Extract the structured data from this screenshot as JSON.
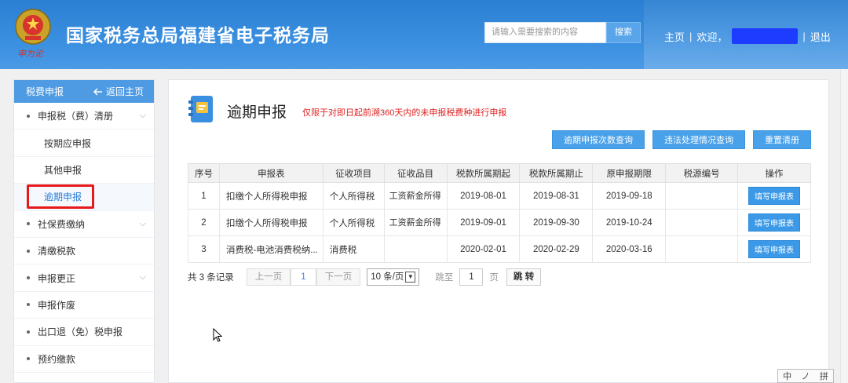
{
  "header": {
    "site_title": "国家税务总局福建省电子税务局",
    "signature": "申为论",
    "search_placeholder": "请输入需要搜索的内容",
    "search_button": "搜索",
    "nav_home": "主页",
    "nav_sep": "|",
    "nav_welcome": "欢迎，",
    "nav_logout": "退出"
  },
  "sidebar": {
    "title": "税费申报",
    "back_label": "返回主页",
    "items": [
      {
        "label": "申报税（费）清册"
      },
      {
        "label": "按期应申报"
      },
      {
        "label": "其他申报"
      },
      {
        "label": "逾期申报"
      },
      {
        "label": "社保费缴纳"
      },
      {
        "label": "清缴税款"
      },
      {
        "label": "申报更正"
      },
      {
        "label": "申报作废"
      },
      {
        "label": "出口退（免）税申报"
      },
      {
        "label": "预约缴款"
      }
    ]
  },
  "main": {
    "title": "逾期申报",
    "note": "仅限于对即日起前溯360天内的未申报税费种进行申报",
    "actions": [
      "逾期申报次数查询",
      "违法处理情况查询",
      "重置清册"
    ],
    "table": {
      "headers": [
        "序号",
        "申报表",
        "征收项目",
        "征收品目",
        "税款所属期起",
        "税款所属期止",
        "原申报期限",
        "税源编号",
        "操作"
      ],
      "rows": [
        {
          "no": "1",
          "form": "扣缴个人所得税申报",
          "project": "个人所得税",
          "item": "工资薪金所得",
          "start": "2019-08-01",
          "end": "2019-08-31",
          "deadline": "2019-09-18",
          "source": "",
          "op": "填写申报表"
        },
        {
          "no": "2",
          "form": "扣缴个人所得税申报",
          "project": "个人所得税",
          "item": "工资薪金所得",
          "start": "2019-09-01",
          "end": "2019-09-30",
          "deadline": "2019-10-24",
          "source": "",
          "op": "填写申报表"
        },
        {
          "no": "3",
          "form": "消费税-电池消费税纳...",
          "project": "消费税",
          "item": "",
          "start": "2020-02-01",
          "end": "2020-02-29",
          "deadline": "2020-03-16",
          "source": "",
          "op": "填写申报表"
        }
      ]
    },
    "pager": {
      "total": "共 3 条记录",
      "prev": "上一页",
      "current": "1",
      "next": "下一页",
      "page_size": "10 条/页",
      "jump_label": "跳至",
      "jump_value": "1",
      "page_unit": "页",
      "jump_button": "跳 转"
    }
  },
  "ime": {
    "mode": "中",
    "punct": "ノ",
    "extra": "拼"
  }
}
